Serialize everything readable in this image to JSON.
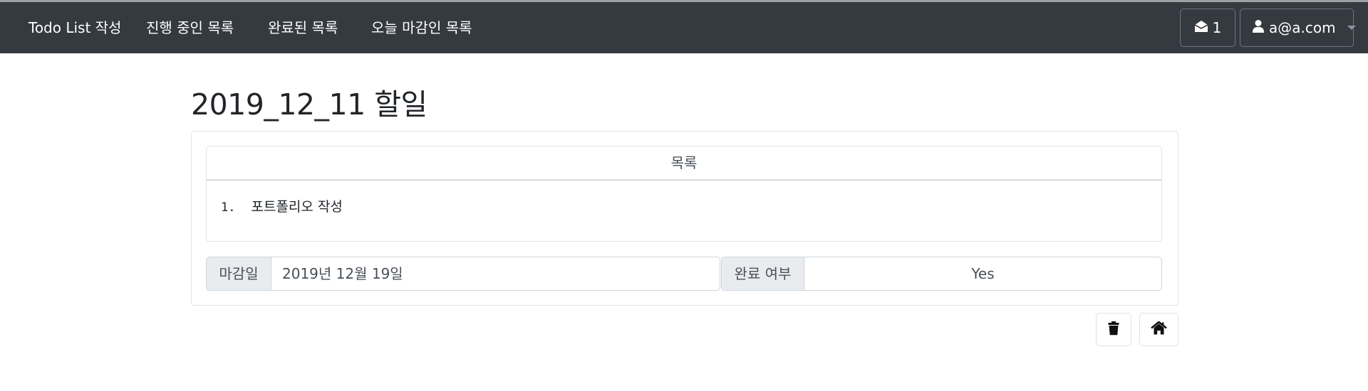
{
  "nav": {
    "items": [
      {
        "label": "Todo List 작성"
      },
      {
        "label": "진행 중인 목록"
      },
      {
        "label": "완료된 목록"
      },
      {
        "label": "오늘 마감인 목록"
      }
    ],
    "messages": {
      "icon": "envelope-open-icon",
      "count": "1"
    },
    "user": {
      "icon": "user-icon",
      "email": "a@a.com"
    }
  },
  "page": {
    "title": "2019_12_11 할일"
  },
  "todo_list": {
    "header": "목록",
    "items": [
      {
        "number": "1.",
        "text": "포트폴리오 작성"
      }
    ]
  },
  "fields": {
    "deadline_label": "마감일",
    "deadline_value": "2019년 12월 19일",
    "done_label": "완료 여부",
    "done_value": "Yes"
  },
  "actions": {
    "delete_icon": "trash-icon",
    "home_icon": "home-icon"
  },
  "colors": {
    "navbar": "#343a40",
    "border": "#dee2e6",
    "input_group_label_bg": "#e9ecef"
  }
}
